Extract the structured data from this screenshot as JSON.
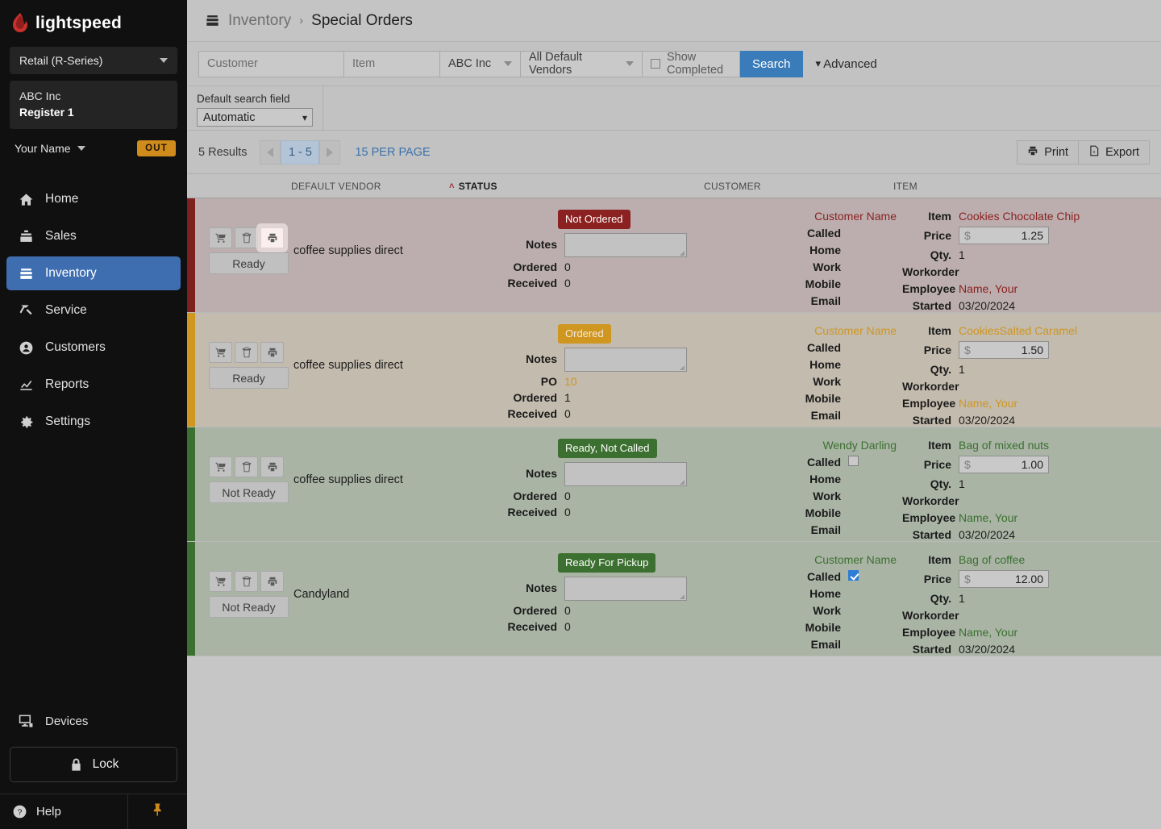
{
  "sidebar": {
    "brand": "lightspeed",
    "product_selector": "Retail (R-Series)",
    "store": {
      "name": "ABC Inc",
      "register": "Register 1"
    },
    "user": {
      "name": "Your Name",
      "out_label": "OUT"
    },
    "nav": [
      {
        "label": "Home",
        "icon": "home-icon",
        "active": false
      },
      {
        "label": "Sales",
        "icon": "sales-icon",
        "active": false
      },
      {
        "label": "Inventory",
        "icon": "inventory-icon",
        "active": true
      },
      {
        "label": "Service",
        "icon": "service-hammer-icon",
        "active": false
      },
      {
        "label": "Customers",
        "icon": "customers-icon",
        "active": false
      },
      {
        "label": "Reports",
        "icon": "reports-chart-icon",
        "active": false
      },
      {
        "label": "Settings",
        "icon": "gear-icon",
        "active": false
      }
    ],
    "devices": "Devices",
    "lock": "Lock",
    "help": "Help",
    "pin_icon": "pin-icon"
  },
  "header": {
    "breadcrumb_icon": "inventory-icon",
    "breadcrumb_parent": "Inventory",
    "breadcrumb_sep": "›",
    "breadcrumb_current": "Special Orders"
  },
  "search": {
    "customer_placeholder": "Customer",
    "customer_value": "",
    "item_placeholder": "Item",
    "item_value": "",
    "shop_select": "ABC Inc",
    "vendor_select": "All Default Vendors",
    "show_completed_label": "Show Completed",
    "show_completed_checked": false,
    "search_button": "Search",
    "advanced_label": "Advanced",
    "default_search_field_label": "Default search field",
    "default_search_field_value": "Automatic"
  },
  "results": {
    "count_label": "5 Results",
    "page_range": "1 - 5",
    "per_page": "15 PER PAGE",
    "print_label": "Print",
    "export_label": "Export"
  },
  "columns": {
    "vendor": "DEFAULT VENDOR",
    "status": "STATUS",
    "status_sort": "˄",
    "customer": "CUSTOMER",
    "item": "ITEM"
  },
  "labels": {
    "notes": "Notes",
    "po": "PO",
    "ordered": "Ordered",
    "received": "Received",
    "called": "Called",
    "home": "Home",
    "work": "Work",
    "mobile": "Mobile",
    "email": "Email",
    "item": "Item",
    "price": "Price",
    "qty": "Qty.",
    "workorder": "Workorder",
    "employee": "Employee",
    "started": "Started",
    "currency": "$"
  },
  "colors": {
    "accent_blue": "#3a7cb9",
    "status_red": "#8b2121",
    "status_orange": "#cf9620",
    "status_green": "#3c7030",
    "sidebar_active": "#3f6eb0",
    "out_badge": "#d08b1d"
  },
  "rows": [
    {
      "theme": "red",
      "ready_button": "Ready",
      "vendor": "coffee supplies direct",
      "status_badge": "Not Ordered",
      "notes": "",
      "po": null,
      "ordered": "0",
      "received": "0",
      "customer_name": "Customer Name",
      "called_checkbox": null,
      "home": "",
      "work": "",
      "mobile": "",
      "email": "",
      "item": "Cookies Chocolate Chip",
      "price": "1.25",
      "qty": "1",
      "workorder": "",
      "employee": "Name, Your",
      "started": "03/20/2024",
      "print_hover": true
    },
    {
      "theme": "orange",
      "ready_button": "Ready",
      "vendor": "coffee supplies direct",
      "status_badge": "Ordered",
      "notes": "",
      "po": "10",
      "ordered": "1",
      "received": "0",
      "customer_name": "Customer Name",
      "called_checkbox": null,
      "home": "",
      "work": "",
      "mobile": "",
      "email": "",
      "item": "CookiesSalted Caramel",
      "price": "1.50",
      "qty": "1",
      "workorder": "",
      "employee": "Name, Your",
      "started": "03/20/2024",
      "print_hover": false
    },
    {
      "theme": "green",
      "ready_button": "Not Ready",
      "vendor": "coffee supplies direct",
      "status_badge": "Ready, Not Called",
      "notes": "",
      "po": null,
      "ordered": "0",
      "received": "0",
      "customer_name": "Wendy Darling",
      "called_checkbox": false,
      "home": "",
      "work": "",
      "mobile": "",
      "email": "",
      "item": "Bag of mixed nuts",
      "price": "1.00",
      "qty": "1",
      "workorder": "",
      "employee": "Name, Your",
      "started": "03/20/2024",
      "print_hover": false
    },
    {
      "theme": "green",
      "ready_button": "Not Ready",
      "vendor": "Candyland",
      "status_badge": "Ready For Pickup",
      "notes": "",
      "po": null,
      "ordered": "0",
      "received": "0",
      "customer_name": "Customer Name",
      "called_checkbox": true,
      "home": "",
      "work": "",
      "mobile": "",
      "email": "",
      "item": "Bag of coffee",
      "price": "12.00",
      "qty": "1",
      "workorder": "",
      "employee": "Name, Your",
      "started": "03/20/2024",
      "print_hover": false
    }
  ]
}
